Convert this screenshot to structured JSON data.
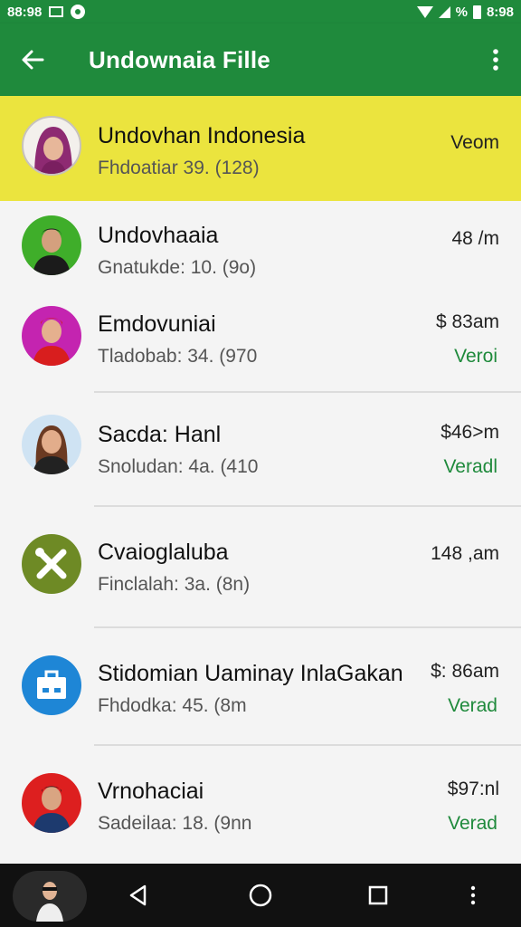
{
  "status_bar": {
    "time_left": "88:98",
    "battery_text": "%",
    "time_right": "8:98"
  },
  "app_bar": {
    "title": "Undownaia Fille"
  },
  "items": [
    {
      "name": "Undovhan Indonesia",
      "sub": "Fhdoatiar 39. (128)",
      "time": "Veom",
      "status": ""
    },
    {
      "name": "Undovhaaia",
      "sub": "Gnatukde: 10. (9o)",
      "time": "48 /m",
      "status": ""
    },
    {
      "name": "Emdovuniai",
      "sub": "Tladobab: 34. (970",
      "time": "$ 83am",
      "status": "Veroi"
    },
    {
      "name": "Sacda: Hanl",
      "sub": "Snoludan: 4a. (410",
      "time": "$46>m",
      "status": "Veradl"
    },
    {
      "name": "Cvaioglaluba",
      "sub": "Finclalah: 3a. (8n)",
      "time": "148 ,am",
      "status": ""
    },
    {
      "name": "Stidomian Uaminay InlaGakan",
      "sub": "Fhdodka: 45. (8m",
      "time": "$: 86am",
      "status": "Verad"
    },
    {
      "name": "Vrnohaciai",
      "sub": "Sadeilaa: 18. (9nn",
      "time": "$97:nl",
      "status": "Verad"
    }
  ],
  "colors": {
    "primary": "#1f8a3c",
    "highlight": "#ebe43e",
    "status_text": "#1f8a3c"
  }
}
